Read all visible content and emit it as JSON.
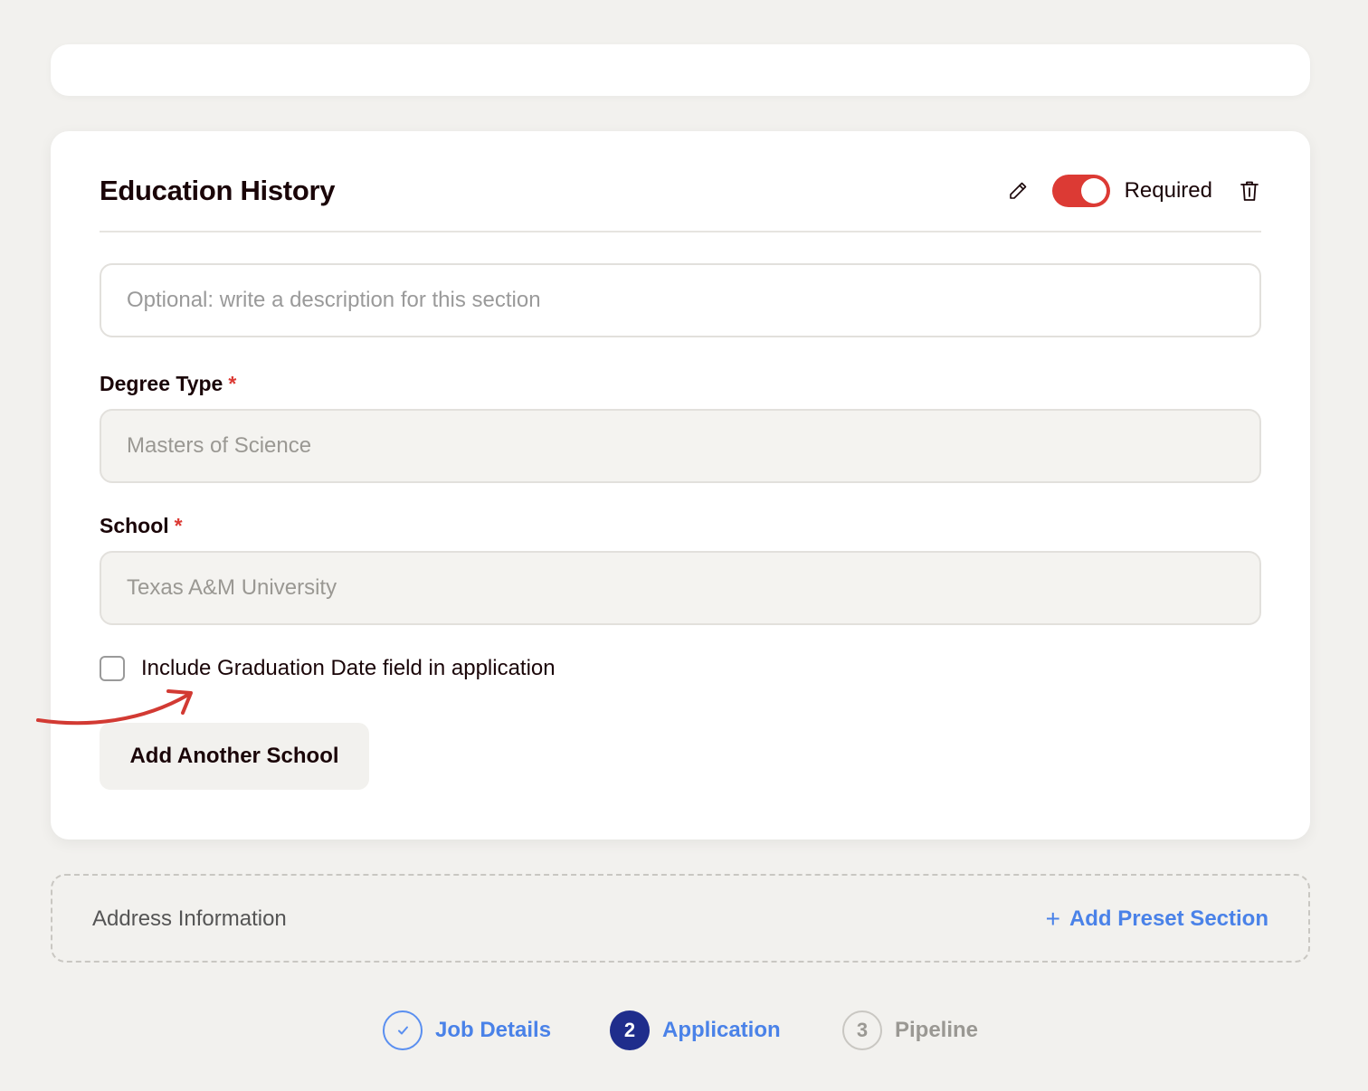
{
  "section": {
    "title": "Education History",
    "required_label": "Required",
    "required_on": true,
    "description_placeholder": "Optional: write a description for this section",
    "description_value": ""
  },
  "fields": [
    {
      "label": "Degree Type",
      "required_mark": "*",
      "value": "Masters of Science"
    },
    {
      "label": "School",
      "required_mark": "*",
      "value": "Texas A&M University"
    }
  ],
  "graduation_checkbox": {
    "label": "Include Graduation Date field in application",
    "checked": false
  },
  "add_school_button": "Add Another School",
  "address_section": {
    "label": "Address Information",
    "add_preset_label": "Add Preset Section",
    "add_preset_icon": "+"
  },
  "stepper": {
    "steps": [
      {
        "number": "",
        "label": "Job Details",
        "state": "done"
      },
      {
        "number": "2",
        "label": "Application",
        "state": "active"
      },
      {
        "number": "3",
        "label": "Pipeline",
        "state": "pending"
      }
    ]
  },
  "colors": {
    "accent_red": "#dc3a34",
    "link_blue": "#4a82e8",
    "active_step": "#1f2d8c",
    "page_background": "#f2f1ee"
  }
}
